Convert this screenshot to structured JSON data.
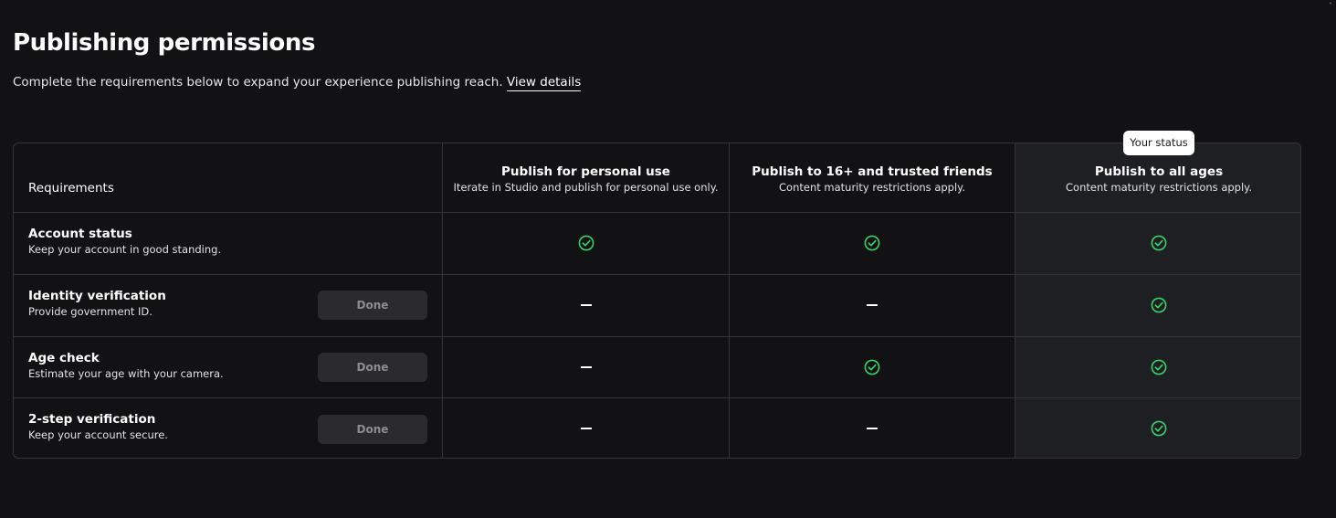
{
  "header": {
    "title": "Publishing permissions",
    "subtitle": "Complete the requirements below to expand your experience publishing reach.",
    "view_details_label": "View details"
  },
  "table": {
    "requirements_label": "Requirements",
    "status_badge": "Your status",
    "columns": [
      {
        "title": "Publish for personal use",
        "subtitle": "Iterate in Studio and publish for personal use only."
      },
      {
        "title": "Publish to 16+ and trusted friends",
        "subtitle": "Content maturity restrictions apply."
      },
      {
        "title": "Publish to all ages",
        "subtitle": "Content maturity restrictions apply."
      }
    ],
    "rows": [
      {
        "title": "Account status",
        "description": "Keep your account in good standing.",
        "button": null,
        "cells": [
          "check",
          "check",
          "check"
        ]
      },
      {
        "title": "Identity verification",
        "description": "Provide government ID.",
        "button": "Done",
        "cells": [
          "dash",
          "dash",
          "check"
        ]
      },
      {
        "title": "Age check",
        "description": "Estimate your age with your camera.",
        "button": "Done",
        "cells": [
          "dash",
          "check",
          "check"
        ]
      },
      {
        "title": "2-step verification",
        "description": "Keep your account secure.",
        "button": "Done",
        "cells": [
          "dash",
          "dash",
          "check"
        ]
      }
    ]
  },
  "colors": {
    "background": "#121214",
    "check": "#3ecf6a",
    "highlight_column": "#1e1f23",
    "border": "#34343a"
  }
}
